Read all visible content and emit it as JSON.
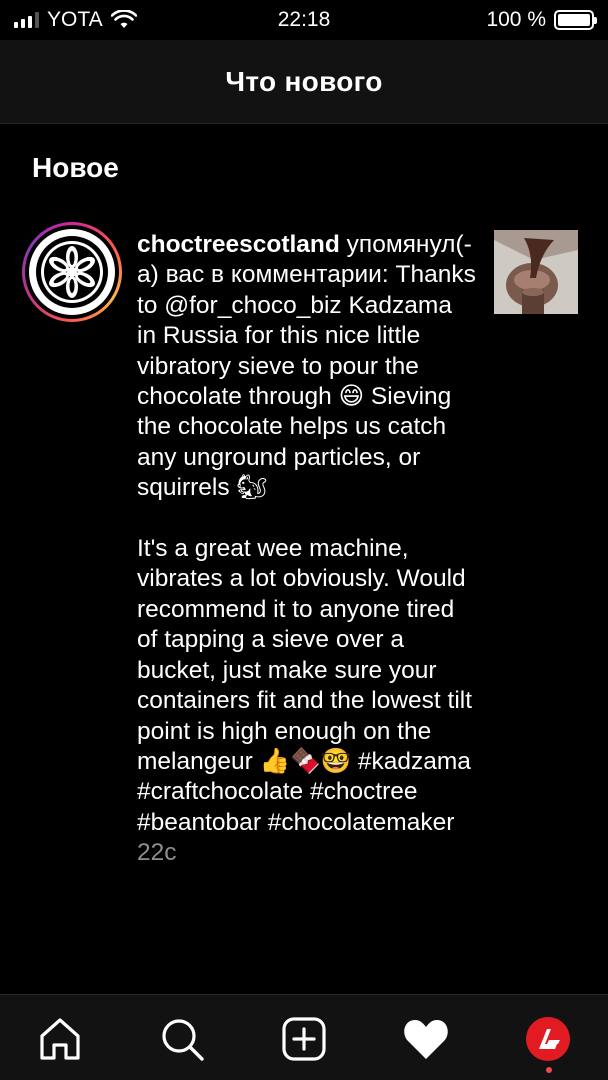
{
  "status_bar": {
    "carrier": "YOTA",
    "time": "22:18",
    "battery_percent": "100 %"
  },
  "header": {
    "title": "Что нового"
  },
  "section": {
    "title": "Новое"
  },
  "notification": {
    "username": "choctreescotland",
    "action": " упомянул(-а) вас в комментарии: ",
    "comment": "Thanks to @for_choco_biz Kadzama in Russia for this nice little vibratory sieve to pour the chocolate through 😄 Sieving the chocolate helps us catch any unground particles, or squirrels 🐿\n\nIt's a great wee machine, vibrates a lot obviously. Would recommend it to anyone tired of tapping a sieve over a bucket, just make sure your containers fit and the lowest tilt point is high enough on the melangeur 👍🍫🤓 #kadzama #craftchocolate #choctree #beantobar #chocolatemaker",
    "timestamp": " 22с"
  },
  "tabbar": {
    "items": [
      "home-icon",
      "search-icon",
      "new-post-icon",
      "activity-heart-icon",
      "profile-avatar-icon"
    ],
    "active_color": "#ffffff",
    "notification_dot_color": "#ed4956"
  }
}
